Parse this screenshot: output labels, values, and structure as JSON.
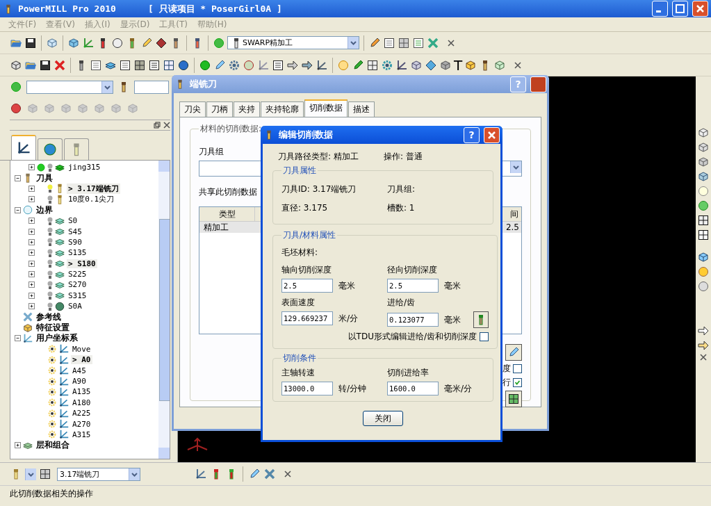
{
  "window": {
    "title": "PowerMILL Pro 2010",
    "project": "[ 只读项目 * PoserGirl0A ]"
  },
  "menu": [
    {
      "label": "文件(F)",
      "disabled": true
    },
    {
      "label": "查看(V)",
      "disabled": true
    },
    {
      "label": "插入(I)",
      "disabled": true
    },
    {
      "label": "显示(D)",
      "disabled": true
    },
    {
      "label": "工具(T)",
      "disabled": true
    },
    {
      "label": "帮助(H)",
      "disabled": true
    }
  ],
  "toolbar": {
    "strategy_combo": "SWARP精加工",
    "text_tool": "T"
  },
  "explorer": {
    "tabs": [
      {
        "selected": true
      },
      {
        "selected": false
      },
      {
        "selected": false
      }
    ],
    "tree": [
      {
        "children": [
          {
            "label": "jing315",
            "kind": "toolpath",
            "calculated": true,
            "lit": false,
            "expanded": false
          }
        ]
      },
      {
        "label": "刀具",
        "kind": "tools",
        "expanded": true,
        "children": [
          {
            "label": "> 3.17端铣刀",
            "kind": "tool",
            "lit": true,
            "active": true,
            "expanded": false
          },
          {
            "label": "10度0.1尖刀",
            "kind": "tool",
            "lit": false,
            "active": false,
            "expanded": false
          }
        ]
      },
      {
        "label": "边界",
        "kind": "boundaries",
        "expanded": true,
        "children": [
          {
            "label": "S0",
            "kind": "boundary",
            "lit": false,
            "active": false,
            "expanded": false
          },
          {
            "label": "S45",
            "kind": "boundary",
            "lit": false,
            "active": false,
            "expanded": false
          },
          {
            "label": "S90",
            "kind": "boundary",
            "lit": false,
            "active": false,
            "expanded": false
          },
          {
            "label": "S135",
            "kind": "boundary",
            "lit": false,
            "active": false,
            "expanded": false
          },
          {
            "label": "> S180",
            "kind": "boundary",
            "lit": false,
            "active": true,
            "expanded": false
          },
          {
            "label": "S225",
            "kind": "boundary",
            "lit": false,
            "active": false,
            "expanded": false
          },
          {
            "label": "S270",
            "kind": "boundary",
            "lit": false,
            "active": false,
            "expanded": false
          },
          {
            "label": "S315",
            "kind": "boundary",
            "lit": false,
            "active": false,
            "expanded": false
          },
          {
            "label": "S0A",
            "kind": "boundary-empty",
            "lit": false,
            "active": false,
            "expanded": false
          }
        ]
      },
      {
        "label": "参考线",
        "kind": "patterns"
      },
      {
        "label": "特征设置",
        "kind": "features"
      },
      {
        "label": "用户坐标系",
        "kind": "workplanes",
        "expanded": true,
        "children": [
          {
            "label": "Move",
            "kind": "workplane",
            "active": false
          },
          {
            "label": "> A0",
            "kind": "workplane",
            "active": true
          },
          {
            "label": "A45",
            "kind": "workplane",
            "active": false
          },
          {
            "label": "A90",
            "kind": "workplane",
            "active": false
          },
          {
            "label": "A135",
            "kind": "workplane",
            "active": false
          },
          {
            "label": "A180",
            "kind": "workplane",
            "active": false
          },
          {
            "label": "A225",
            "kind": "workplane",
            "active": false
          },
          {
            "label": "A270",
            "kind": "workplane",
            "active": false
          },
          {
            "label": "A315",
            "kind": "workplane",
            "active": false
          }
        ]
      },
      {
        "label": "层和组合",
        "kind": "layers",
        "expanded": false
      }
    ]
  },
  "tool_toolbar": {
    "tool_combo": "3.17端铣刀"
  },
  "status_bar": "此切削数据相关的操作",
  "tool_dialog": {
    "title": "端铣刀",
    "help_button": "?",
    "tabs": [
      {
        "label": "刀尖",
        "selected": false
      },
      {
        "label": "刀柄",
        "selected": false
      },
      {
        "label": "夹持",
        "selected": false
      },
      {
        "label": "夹持轮廓",
        "selected": false
      },
      {
        "label": "切削数据",
        "selected": true
      },
      {
        "label": "描述",
        "selected": false
      }
    ],
    "group_title": "材料的切削数据:",
    "tool_group_label": "刀具组",
    "shared_label": "共享此切削数据",
    "table": {
      "columns": [
        "类型",
        "间"
      ],
      "rows": [
        [
          "精加工",
          "2.5"
        ]
      ]
    },
    "checkboxes": [
      {
        "label": "度",
        "checked": false
      },
      {
        "label": "行",
        "checked": true
      }
    ]
  },
  "cutting_dialog": {
    "title": "编辑切削数据",
    "help_button": "?",
    "toolpath_type": "刀具路径类型: 精加工",
    "operation": "操作: 普通",
    "tool_group": {
      "title": "刀具属性",
      "items": [
        "刀具ID: 3.17端铣刀",
        "刀具组:",
        "直径: 3.175",
        "槽数: 1"
      ]
    },
    "material_group": {
      "title": "刀具/材料属性",
      "stock_label": "毛坯材料:",
      "fields": [
        {
          "label": "轴向切削深度",
          "value": "2.5",
          "unit": "毫米"
        },
        {
          "label": "径向切削深度",
          "value": "2.5",
          "unit": "毫米"
        },
        {
          "label": "表面速度",
          "value": "129.669237",
          "unit": "米/分"
        },
        {
          "label": "进给/齿",
          "value": "0.123077",
          "unit": "毫米"
        }
      ],
      "checkbox": {
        "label": "以TDU形式编辑进给/齿和切削深度",
        "checked": false
      }
    },
    "conditions_group": {
      "title": "切削条件",
      "fields": [
        {
          "label": "主轴转速",
          "value": "13000.0",
          "unit": "转/分钟"
        },
        {
          "label": "切削进给率",
          "value": "1600.0",
          "unit": "毫米/分"
        }
      ]
    },
    "close_button": "关闭"
  }
}
